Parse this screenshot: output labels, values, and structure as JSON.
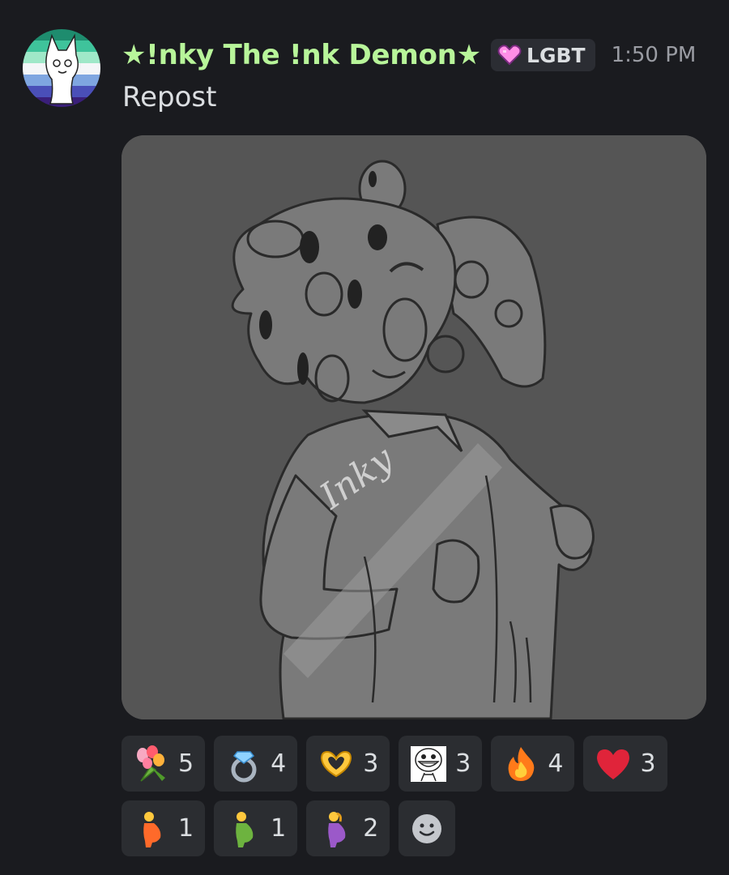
{
  "message": {
    "author": "★!nky The !nk Demon★",
    "badge": {
      "label": "LGBT",
      "icon": "pink-heart-icon"
    },
    "timestamp": "1:50 PM",
    "text": "Repost",
    "attachment": {
      "type": "drawing",
      "signature": "Inky"
    }
  },
  "reactions": [
    {
      "icon": "tulip-bouquet-icon",
      "count": "5"
    },
    {
      "icon": "diamond-ring-icon",
      "count": "4"
    },
    {
      "icon": "heart-hands-icon",
      "count": "3"
    },
    {
      "icon": "grinning-meme-icon",
      "count": "3"
    },
    {
      "icon": "fire-icon",
      "count": "4"
    },
    {
      "icon": "red-heart-icon",
      "count": "3"
    },
    {
      "icon": "pregnant-person-orange-icon",
      "count": "1"
    },
    {
      "icon": "pregnant-person-green-icon",
      "count": "1"
    },
    {
      "icon": "pregnant-person-purple-icon",
      "count": "2"
    }
  ],
  "colors": {
    "background": "#1a1b1f",
    "username": "#b8f59a",
    "reaction_bg": "#2b2d31",
    "timestamp": "#9a9ca3"
  }
}
